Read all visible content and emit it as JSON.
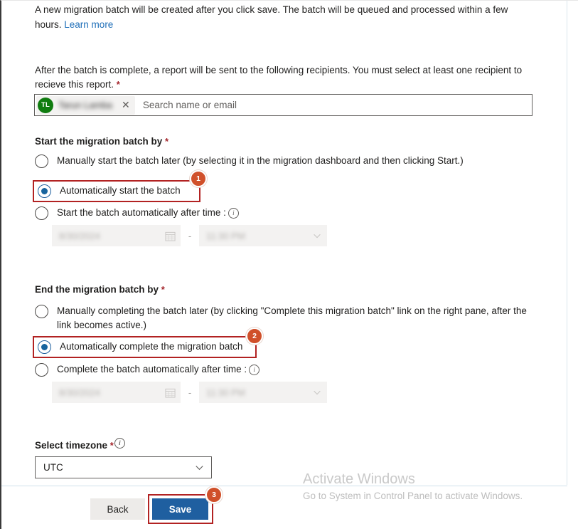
{
  "intro": {
    "text": "A new migration batch will be created after you click save. The batch will be queued and processed within a few hours. ",
    "link_label": "Learn more"
  },
  "recipients": {
    "description": "After the batch is complete, a report will be sent to the following recipients. You must select at least one recipient to recieve this report. ",
    "required_marker": "*",
    "chip": {
      "initials": "TL",
      "name": "Tarun Lamba",
      "remove_label": "✕"
    },
    "search_placeholder": "Search name or email",
    "search_value": ""
  },
  "start_section": {
    "heading": "Start the migration batch by ",
    "required_marker": "*",
    "options": [
      {
        "label": "Manually start the batch later (by selecting it in the migration dashboard and then clicking Start.)",
        "checked": false
      },
      {
        "label": "Automatically start the batch",
        "checked": true
      },
      {
        "label": "Start the batch automatically after time :",
        "checked": false,
        "has_info_icon": true
      }
    ],
    "datetime": {
      "date_value": "8/30/2024",
      "separator": "-",
      "time_value": "11:30 PM",
      "disabled": true
    }
  },
  "end_section": {
    "heading": "End the migration batch by ",
    "required_marker": "*",
    "options": [
      {
        "label": "Manually completing the batch later (by clicking \"Complete this migration batch\" link on the right pane, after the link becomes active.)",
        "checked": false
      },
      {
        "label": "Automatically complete the migration batch",
        "checked": true
      },
      {
        "label": "Complete the batch automatically after time :",
        "checked": false,
        "has_info_icon": true
      }
    ],
    "datetime": {
      "date_value": "8/30/2024",
      "separator": "-",
      "time_value": "11:30 PM",
      "disabled": true
    }
  },
  "timezone": {
    "label": "Select timezone ",
    "required_marker": "*",
    "selected": "UTC"
  },
  "footer": {
    "back_label": "Back",
    "save_label": "Save"
  },
  "annotations": {
    "badge_1": "1",
    "badge_2": "2",
    "badge_3": "3",
    "box_color": "#b22222",
    "badge_color": "#d0502a"
  },
  "watermark": {
    "title": "Activate Windows",
    "subtitle": "Go to System in Control Panel to activate Windows."
  },
  "colors": {
    "accent_blue": "#1f5fa0",
    "link_blue": "#1e6eb8",
    "required_red": "#a4262c",
    "avatar_green": "#107c10"
  }
}
